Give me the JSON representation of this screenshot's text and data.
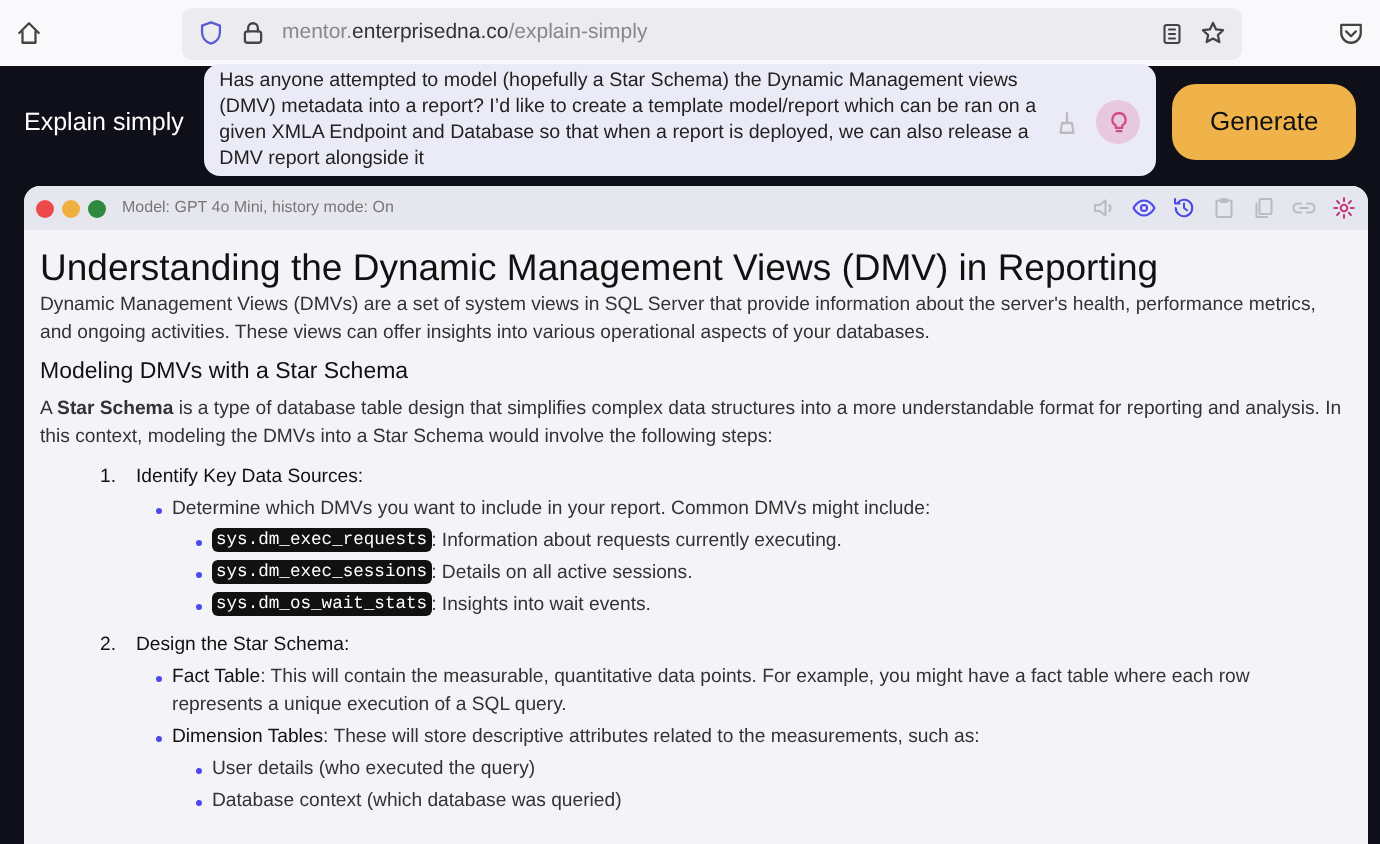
{
  "browser": {
    "url": "mentor.**enterprisedna.co**/explain-simply"
  },
  "app": {
    "label": "Explain simply",
    "query": "Has anyone attempted to model (hopefully a Star Schema) the Dynamic Management views (DMV) metadata into a report? I’d like to create a template model/report which can be ran on a given XMLA Endpoint and Database so that when a report is deployed, we can also release a DMV report alongside it",
    "generate_button": "Generate"
  },
  "result": {
    "status": "Model: GPT 4o Mini, history mode: On",
    "toolbar": [
      {
        "kind": "speaker",
        "active": false
      },
      {
        "kind": "eye",
        "active": true
      },
      {
        "kind": "history",
        "active": true
      },
      {
        "kind": "clipboard",
        "active": false
      },
      {
        "kind": "copy",
        "active": false
      },
      {
        "kind": "link",
        "active": false
      },
      {
        "kind": "gear",
        "active": true
      }
    ],
    "heading": "Understanding the Dynamic Management Views (DMV) in Reporting",
    "intro": "Dynamic Management Views (DMVs) are a set of system views in SQL Server that provide information about the server's health, performance metrics, and ongoing activities. These views can offer insights into various operational aspects of your databases.",
    "subheading": "Modeling DMVs with a Star Schema",
    "paragraph": "A **Star Schema** is a type of database table design that simplifies complex data structures into a more understandable format for reporting and analysis. In this context, modeling the DMVs into a Star Schema would involve the following steps:",
    "steps": [
      {
        "number": "1.",
        "title": "Identify Key Data Sources:",
        "items": [
          {
            "text": "Determine which DMVs you want to include in your report. Common DMVs might include:",
            "children": [
              {
                "code": "sys.dm_exec_requests",
                "text": ": Information about requests currently executing."
              },
              {
                "code": "sys.dm_exec_sessions",
                "text": ": Details on all active sessions."
              },
              {
                "code": "sys.dm_os_wait_stats",
                "text": ": Insights into wait events."
              }
            ]
          }
        ]
      },
      {
        "number": "2.",
        "title": "Design the Star Schema:",
        "items": [
          {
            "text": "**Fact Table**: This will contain the measurable, quantitative data points. For example, you might have a fact table where each row represents a unique execution of a SQL query."
          },
          {
            "text": "**Dimension Tables**: These will store descriptive attributes related to the measurements, such as:",
            "children": [
              {
                "text": "User details (who executed the query)"
              },
              {
                "text": "Database context (which database was queried)"
              }
            ]
          }
        ]
      }
    ]
  }
}
